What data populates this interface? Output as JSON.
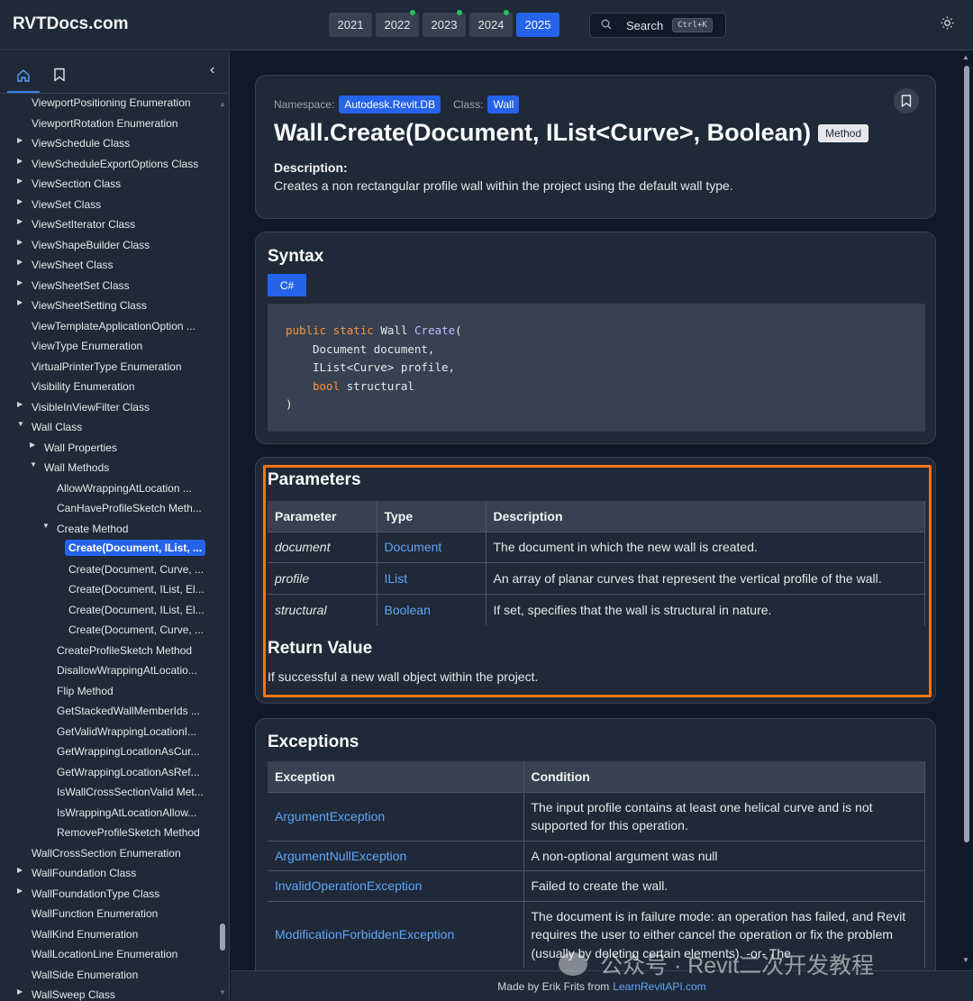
{
  "header": {
    "logo": "RVTDocs.com",
    "years": [
      {
        "label": "2021",
        "dot": false,
        "active": false
      },
      {
        "label": "2022",
        "dot": true,
        "active": false
      },
      {
        "label": "2023",
        "dot": true,
        "active": false
      },
      {
        "label": "2024",
        "dot": true,
        "active": false
      },
      {
        "label": "2025",
        "dot": false,
        "active": true
      }
    ],
    "search_label": "Search",
    "search_shortcut": "Ctrl+K",
    "theme_icon": "sun-icon"
  },
  "sidebar": {
    "tabs": [
      "home-icon",
      "bookmark-icon"
    ],
    "collapse_icon": "chevron-left-icon",
    "items": [
      {
        "label": "ViewportPositioning Enumeration",
        "level": 1,
        "arrow": ""
      },
      {
        "label": "ViewportRotation Enumeration",
        "level": 1,
        "arrow": ""
      },
      {
        "label": "ViewSchedule Class",
        "level": 1,
        "arrow": "▶"
      },
      {
        "label": "ViewScheduleExportOptions Class",
        "level": 1,
        "arrow": "▶"
      },
      {
        "label": "ViewSection Class",
        "level": 1,
        "arrow": "▶"
      },
      {
        "label": "ViewSet Class",
        "level": 1,
        "arrow": "▶"
      },
      {
        "label": "ViewSetIterator Class",
        "level": 1,
        "arrow": "▶"
      },
      {
        "label": "ViewShapeBuilder Class",
        "level": 1,
        "arrow": "▶"
      },
      {
        "label": "ViewSheet Class",
        "level": 1,
        "arrow": "▶"
      },
      {
        "label": "ViewSheetSet Class",
        "level": 1,
        "arrow": "▶"
      },
      {
        "label": "ViewSheetSetting Class",
        "level": 1,
        "arrow": "▶"
      },
      {
        "label": "ViewTemplateApplicationOption ...",
        "level": 1,
        "arrow": ""
      },
      {
        "label": "ViewType Enumeration",
        "level": 1,
        "arrow": ""
      },
      {
        "label": "VirtualPrinterType Enumeration",
        "level": 1,
        "arrow": ""
      },
      {
        "label": "Visibility Enumeration",
        "level": 1,
        "arrow": ""
      },
      {
        "label": "VisibleInViewFilter Class",
        "level": 1,
        "arrow": "▶"
      },
      {
        "label": "Wall Class",
        "level": 1,
        "arrow": "▼"
      },
      {
        "label": "Wall Properties",
        "level": 2,
        "arrow": "▶"
      },
      {
        "label": "Wall Methods",
        "level": 2,
        "arrow": "▼"
      },
      {
        "label": "AllowWrappingAtLocation ...",
        "level": 3,
        "arrow": ""
      },
      {
        "label": "CanHaveProfileSketch Meth...",
        "level": 3,
        "arrow": ""
      },
      {
        "label": "Create Method",
        "level": 3,
        "arrow": "▼"
      },
      {
        "label": "Create(Document, IList, ...",
        "level": 4,
        "arrow": "",
        "selected": true
      },
      {
        "label": "Create(Document, Curve, ...",
        "level": 4,
        "arrow": ""
      },
      {
        "label": "Create(Document, IList, El...",
        "level": 4,
        "arrow": ""
      },
      {
        "label": "Create(Document, IList, El...",
        "level": 4,
        "arrow": ""
      },
      {
        "label": "Create(Document, Curve, ...",
        "level": 4,
        "arrow": ""
      },
      {
        "label": "CreateProfileSketch Method",
        "level": 3,
        "arrow": ""
      },
      {
        "label": "DisallowWrappingAtLocatio...",
        "level": 3,
        "arrow": ""
      },
      {
        "label": "Flip Method",
        "level": 3,
        "arrow": ""
      },
      {
        "label": "GetStackedWallMemberIds ...",
        "level": 3,
        "arrow": ""
      },
      {
        "label": "GetValidWrappingLocationI...",
        "level": 3,
        "arrow": ""
      },
      {
        "label": "GetWrappingLocationAsCur...",
        "level": 3,
        "arrow": ""
      },
      {
        "label": "GetWrappingLocationAsRef...",
        "level": 3,
        "arrow": ""
      },
      {
        "label": "IsWallCrossSectionValid Met...",
        "level": 3,
        "arrow": ""
      },
      {
        "label": "IsWrappingAtLocationAllow...",
        "level": 3,
        "arrow": ""
      },
      {
        "label": "RemoveProfileSketch Method",
        "level": 3,
        "arrow": ""
      },
      {
        "label": "WallCrossSection Enumeration",
        "level": 1,
        "arrow": ""
      },
      {
        "label": "WallFoundation Class",
        "level": 1,
        "arrow": "▶"
      },
      {
        "label": "WallFoundationType Class",
        "level": 1,
        "arrow": "▶"
      },
      {
        "label": "WallFunction Enumeration",
        "level": 1,
        "arrow": ""
      },
      {
        "label": "WallKind Enumeration",
        "level": 1,
        "arrow": ""
      },
      {
        "label": "WallLocationLine Enumeration",
        "level": 1,
        "arrow": ""
      },
      {
        "label": "WallSide Enumeration",
        "level": 1,
        "arrow": ""
      },
      {
        "label": "WallSweep Class",
        "level": 1,
        "arrow": "▶"
      }
    ]
  },
  "main": {
    "namespace_label": "Namespace:",
    "namespace_value": "Autodesk.Revit.DB",
    "class_label": "Class:",
    "class_value": "Wall",
    "title": "Wall.Create(Document, IList<Curve>, Boolean)",
    "badge": "Method",
    "description_label": "Description:",
    "description": "Creates a non rectangular profile wall within the project using the default wall type.",
    "syntax_title": "Syntax",
    "syntax_lang": "C#",
    "code": {
      "line1_kw": "public static",
      "line1_type": "Wall",
      "line1_fn": "Create",
      "line1_paren": "(",
      "line2": "Document document,",
      "line3": "IList<Curve> profile,",
      "line4_kw": "bool",
      "line4_name": "structural",
      "line5": ")"
    },
    "parameters_title": "Parameters",
    "param_headers": [
      "Parameter",
      "Type",
      "Description"
    ],
    "params": [
      {
        "name": "document",
        "type": "Document",
        "description": "The document in which the new wall is created."
      },
      {
        "name": "profile",
        "type": "IList",
        "description": "An array of planar curves that represent the vertical profile of the wall."
      },
      {
        "name": "structural",
        "type": "Boolean",
        "description": "If set, specifies that the wall is structural in nature."
      }
    ],
    "return_title": "Return Value",
    "return_text": "If successful a new wall object within the project.",
    "exceptions_title": "Exceptions",
    "ex_headers": [
      "Exception",
      "Condition"
    ],
    "exceptions": [
      {
        "name": "ArgumentException",
        "condition": "The input profile contains at least one helical curve and is not supported for this operation."
      },
      {
        "name": "ArgumentNullException",
        "condition": "A non-optional argument was null"
      },
      {
        "name": "InvalidOperationException",
        "condition": "Failed to create the wall."
      },
      {
        "name": "ModificationForbiddenException",
        "condition": "The document is in failure mode: an operation has failed, and Revit requires the user to either cancel the operation or fix the problem (usually by deleting certain elements). -or- The"
      }
    ]
  },
  "footer": {
    "text": "Made by Erik Frits from",
    "link": "LearnRevitAPI.com"
  },
  "watermark": "公众号 · Revit二次开发教程"
}
